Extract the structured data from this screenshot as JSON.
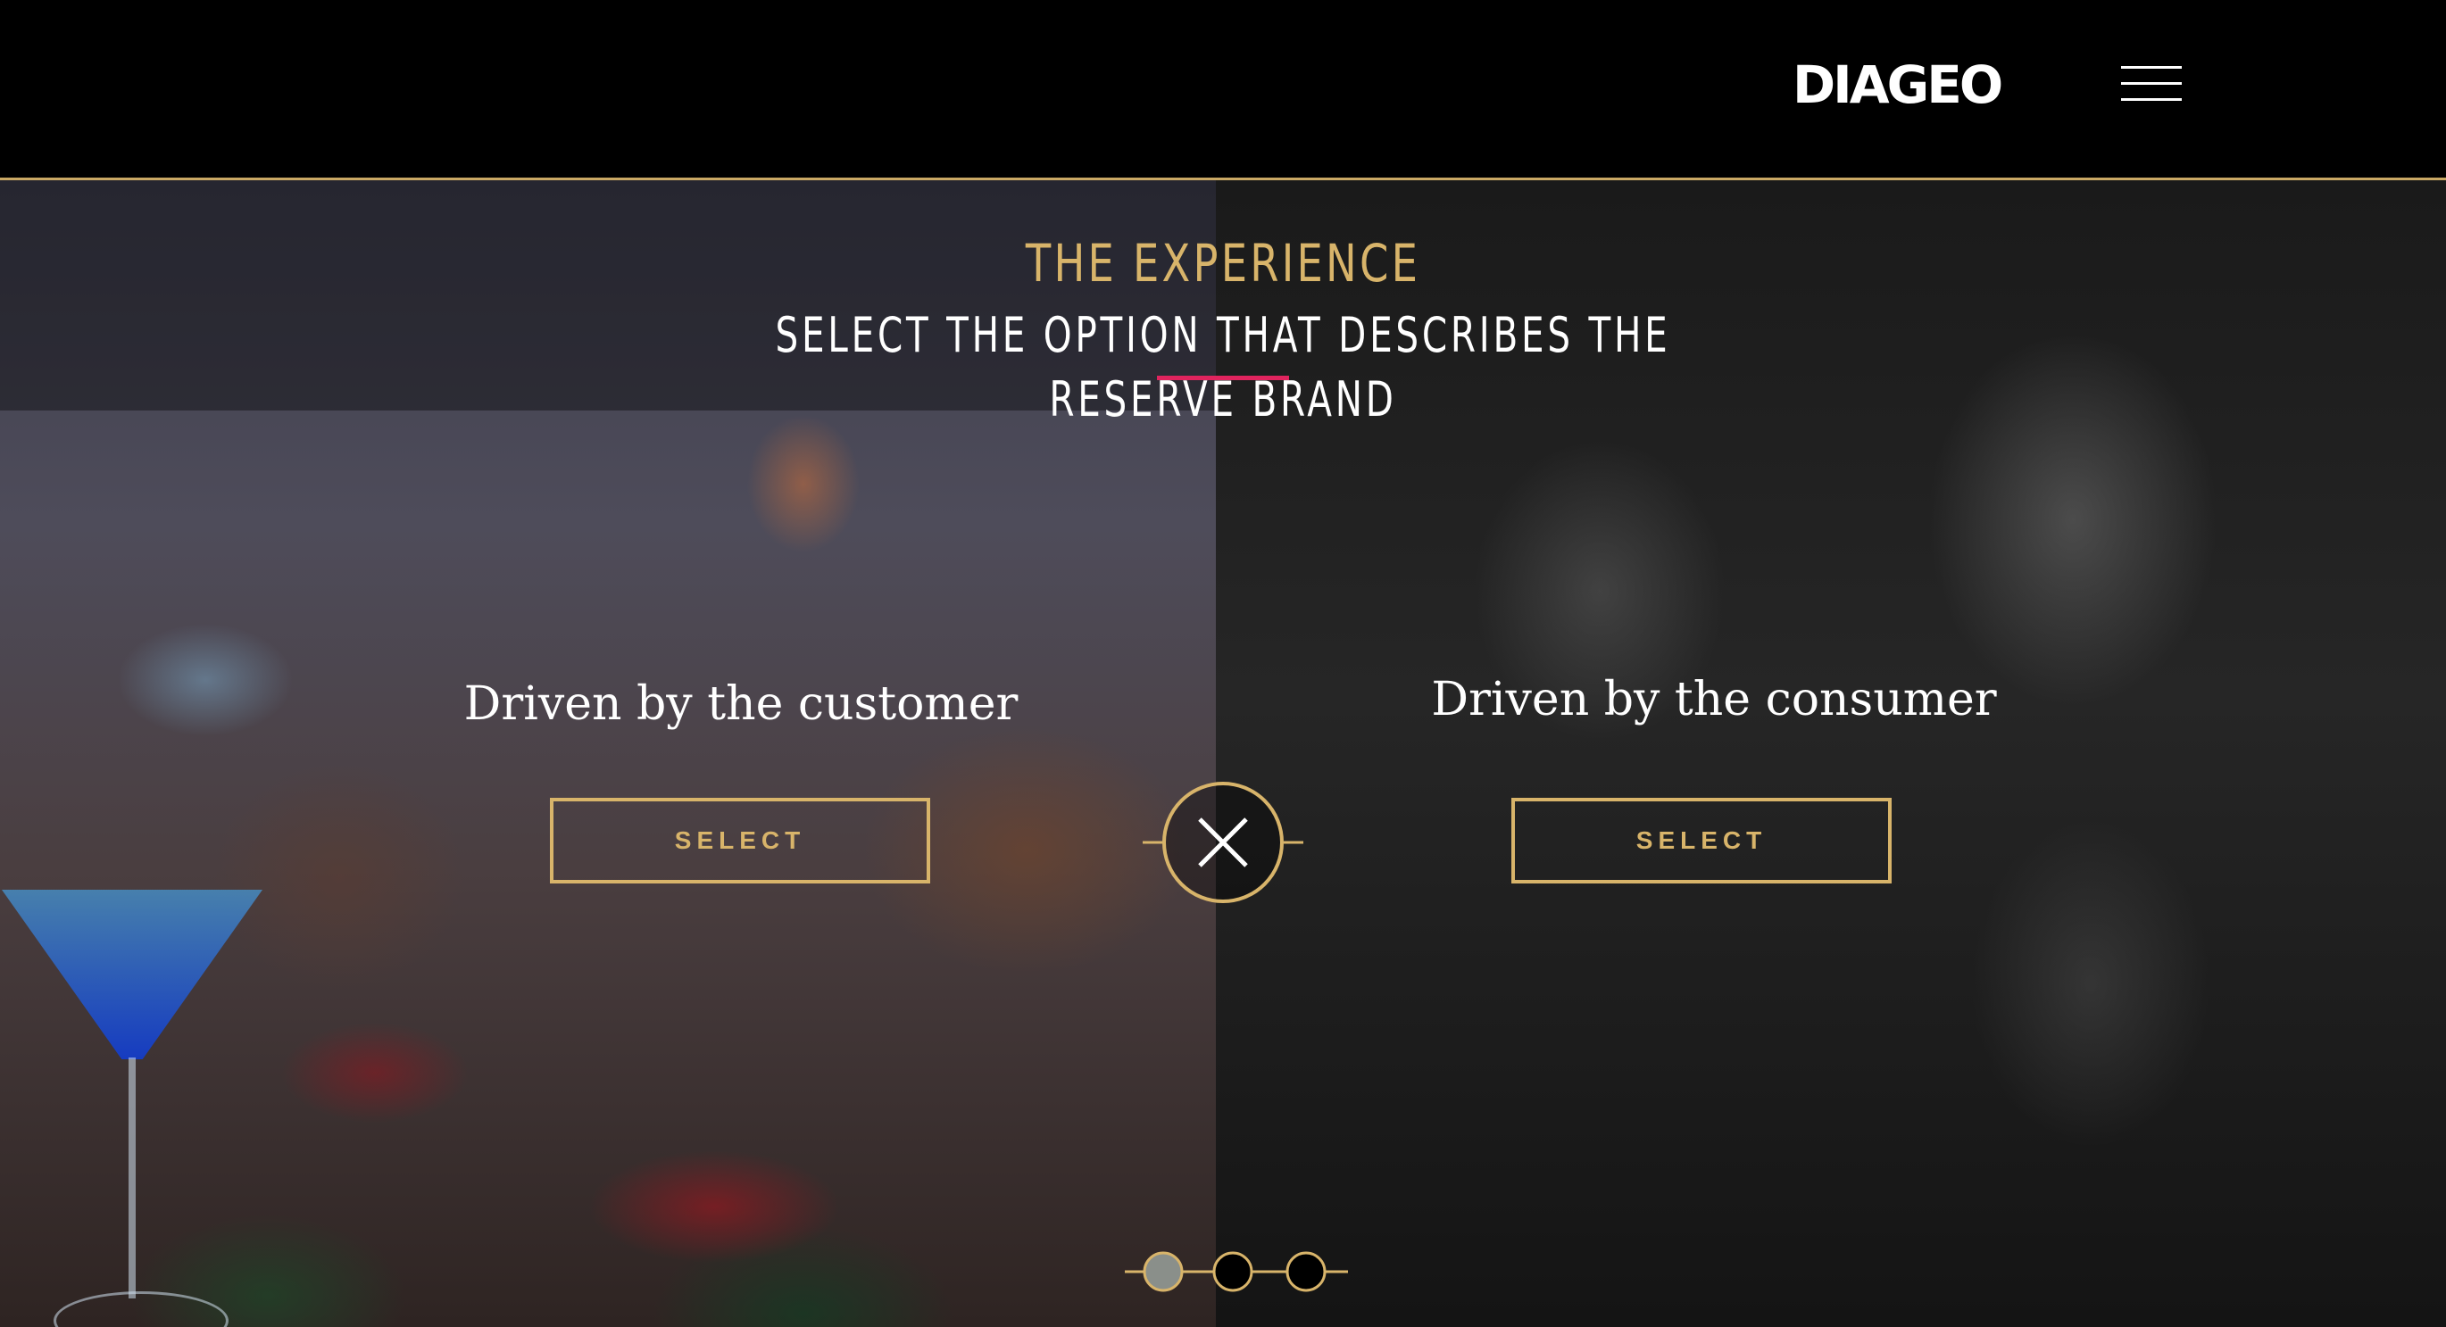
{
  "header": {
    "logo_text": "DIAGEO",
    "menu_icon": "hamburger-menu-icon"
  },
  "intro": {
    "label": "THE EXPERIENCE",
    "heading": "SELECT THE OPTION THAT DESCRIBES THE RESERVE BRAND"
  },
  "options": [
    {
      "title": "Driven by the customer",
      "button_label": "SELECT"
    },
    {
      "title": "Driven by the consumer",
      "button_label": "SELECT"
    }
  ],
  "center_icon": "close-x-icon",
  "progress": {
    "total_steps": 3,
    "current_step": 1
  },
  "colors": {
    "accent_gold": "#d8b46a",
    "accent_pink": "#e0245e",
    "header_border": "#c9a864",
    "header_bg": "#000000"
  }
}
